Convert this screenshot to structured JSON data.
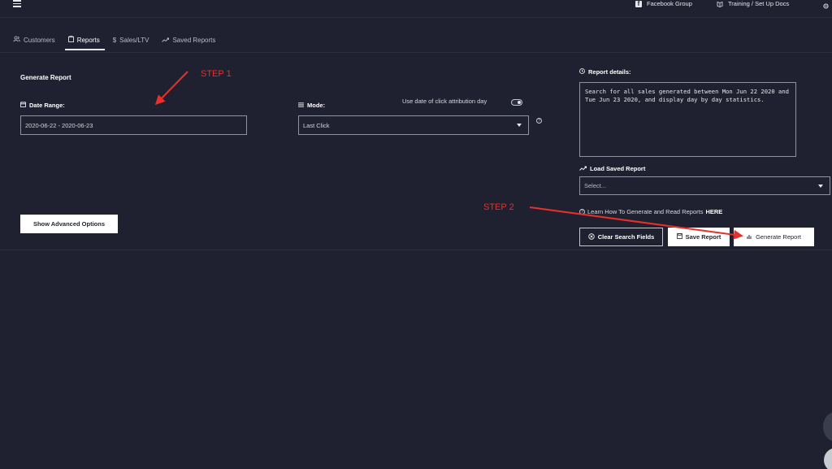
{
  "topbar": {
    "menu_icon": "hamburger-icon",
    "facebook_group": "Facebook Group",
    "training_docs": "Training / Set Up Docs",
    "settings_icon": "gear-icon"
  },
  "tabs": [
    {
      "label": "Customers",
      "icon": "users-icon"
    },
    {
      "label": "Reports",
      "icon": "clipboard-icon"
    },
    {
      "label": "Sales/LTV",
      "icon": "dollar-icon"
    },
    {
      "label": "Saved Reports",
      "icon": "trend-icon"
    }
  ],
  "form": {
    "title": "Generate Report",
    "date_range_label": "Date Range:",
    "date_range_value": "2020-06-22 - 2020-06-23",
    "mode_label": "Mode:",
    "mode_value": "Last Click",
    "attribution_label": "Use date of click attribution day",
    "advanced_button": "Show Advanced Options"
  },
  "details": {
    "label": "Report details:",
    "text": "Search for all sales generated between Mon Jun 22 2020 and Tue Jun 23 2020, and display day by day statistics.",
    "load_label": "Load Saved Report",
    "load_placeholder": "Select...",
    "learn_text": "Learn How To Generate and Read Reports",
    "learn_link": "HERE"
  },
  "actions": {
    "clear": "Clear Search Fields",
    "save": "Save Report",
    "generate": "Generate Report"
  },
  "annotations": {
    "step1": "STEP 1",
    "step2": "STEP 2",
    "color": "#e8302a"
  }
}
